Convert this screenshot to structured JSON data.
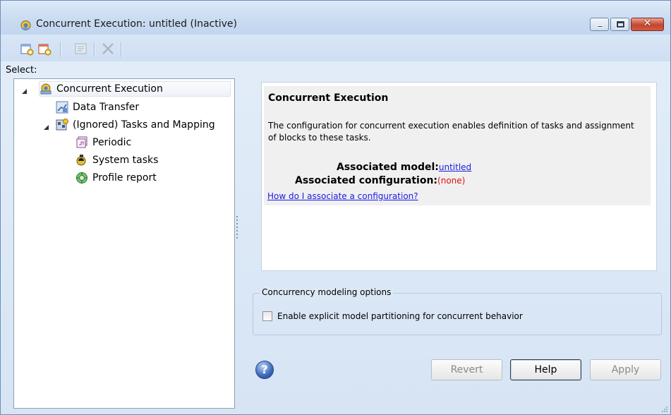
{
  "window": {
    "title": "Concurrent Execution: untitled (Inactive)",
    "controls": [
      "minimize-icon",
      "maximize-icon",
      "close-icon"
    ]
  },
  "toolbar": {
    "buttons": [
      "add-task-icon",
      "add-periodic-icon",
      "properties-icon",
      "delete-icon"
    ]
  },
  "tree": {
    "select_label": "Select:",
    "items": [
      {
        "label": "Concurrent Execution",
        "icon": "concurrent-execution-icon",
        "expanded": true,
        "selected": true
      },
      {
        "label": "Data Transfer",
        "icon": "data-transfer-icon"
      },
      {
        "label": "(Ignored) Tasks and Mapping",
        "icon": "tasks-mapping-icon",
        "expanded": true
      },
      {
        "label": "Periodic",
        "icon": "periodic-icon"
      },
      {
        "label": "System tasks",
        "icon": "system-tasks-icon"
      },
      {
        "label": "Profile report",
        "icon": "profile-report-icon"
      }
    ]
  },
  "info": {
    "title": "Concurrent Execution",
    "description": "The configuration for concurrent execution enables definition of tasks and assignment of blocks to these tasks.",
    "model_label": "Associated model:",
    "model_value": "untitled",
    "config_label": "Associated configuration:",
    "config_value": "(none)",
    "help_link": "How do I associate a configuration?"
  },
  "options": {
    "group_label": "Concurrency modeling options",
    "checkbox_label": "Enable explicit model partitioning for concurrent behavior",
    "checked": false
  },
  "buttons": {
    "revert": "Revert",
    "help": "Help",
    "apply": "Apply",
    "help_glyph": "?"
  },
  "colors": {
    "link": "#1a1ae6",
    "none_value": "#e01010",
    "window_bg": "#d6e4f4"
  }
}
